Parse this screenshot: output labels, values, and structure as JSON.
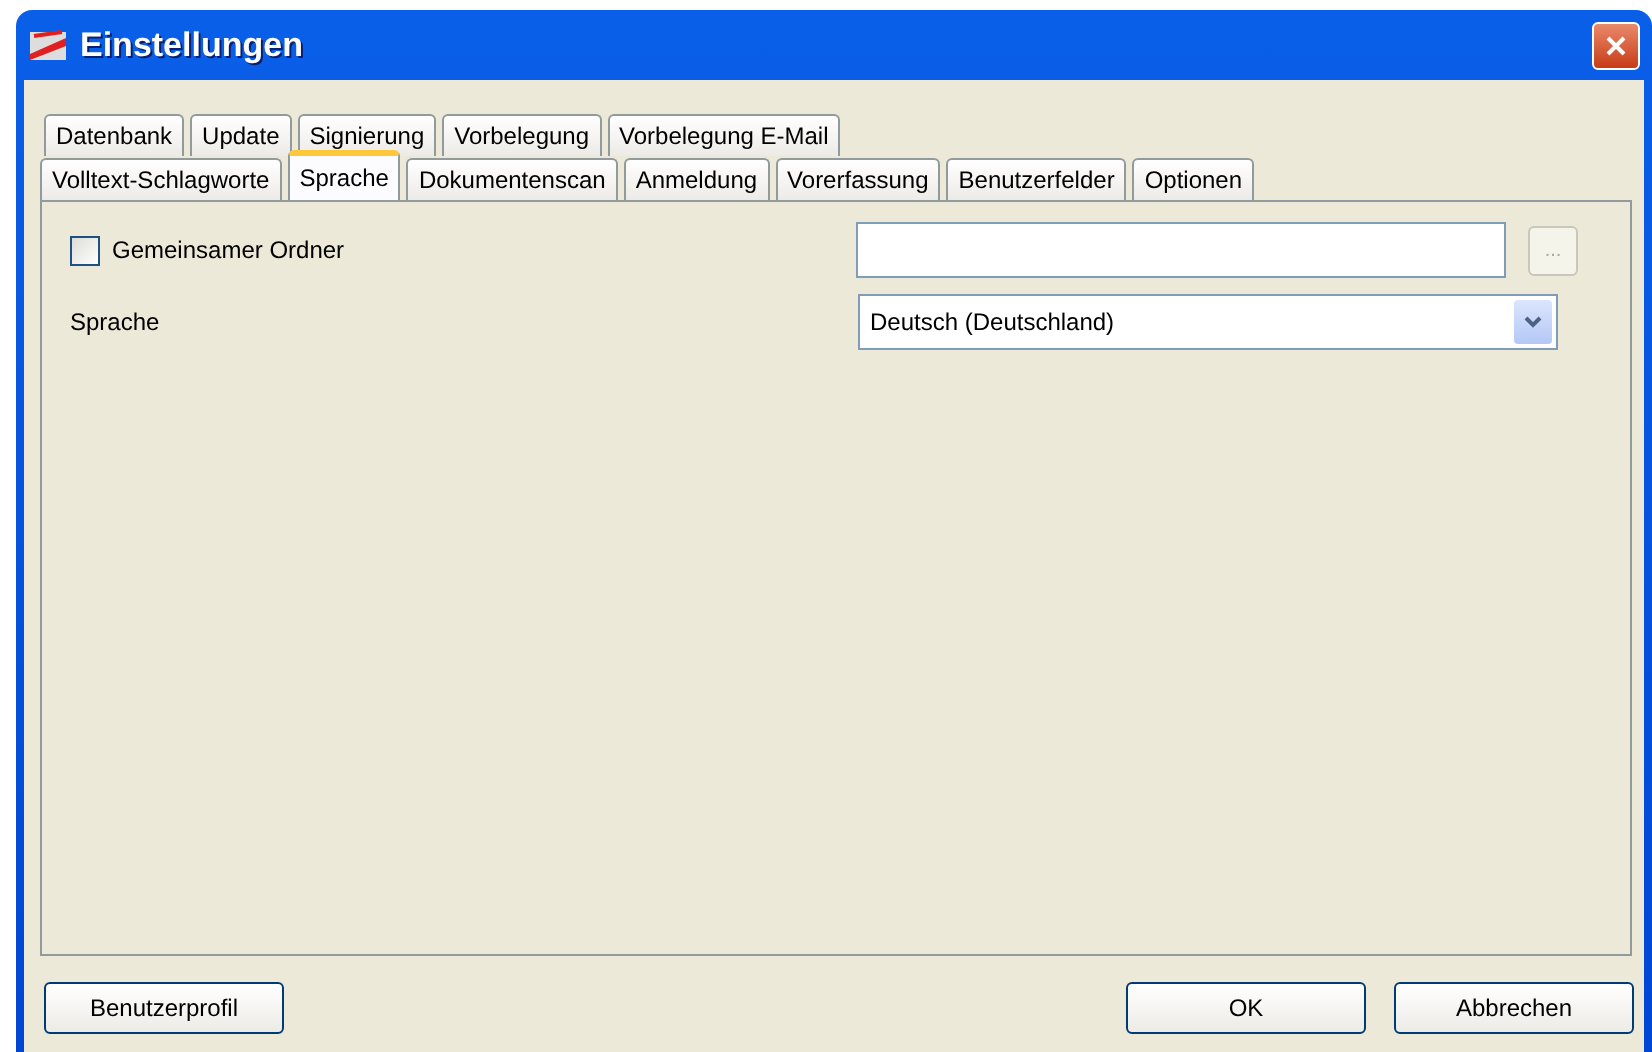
{
  "window": {
    "title": "Einstellungen"
  },
  "tab_rows": [
    [
      {
        "label": "Datenbank",
        "selected": false
      },
      {
        "label": "Update",
        "selected": false
      },
      {
        "label": "Signierung",
        "selected": false
      },
      {
        "label": "Vorbelegung",
        "selected": false
      },
      {
        "label": "Vorbelegung E-Mail",
        "selected": false
      }
    ],
    [
      {
        "label": "Volltext-Schlagworte",
        "selected": false
      },
      {
        "label": "Sprache",
        "selected": true
      },
      {
        "label": "Dokumentenscan",
        "selected": false
      },
      {
        "label": "Anmeldung",
        "selected": false
      },
      {
        "label": "Vorerfassung",
        "selected": false
      },
      {
        "label": "Benutzerfelder",
        "selected": false
      },
      {
        "label": "Optionen",
        "selected": false
      }
    ]
  ],
  "shared_folder": {
    "label": "Gemeinsamer Ordner",
    "checked": false,
    "browse": {
      "label": "...",
      "disabled": true
    }
  },
  "language": {
    "label": "Sprache",
    "value": "Deutsch (Deutschland)"
  },
  "buttons": [
    {
      "label": "Benutzerprofil"
    },
    {
      "label": "OK"
    },
    {
      "label": "Abbrechen"
    }
  ]
}
